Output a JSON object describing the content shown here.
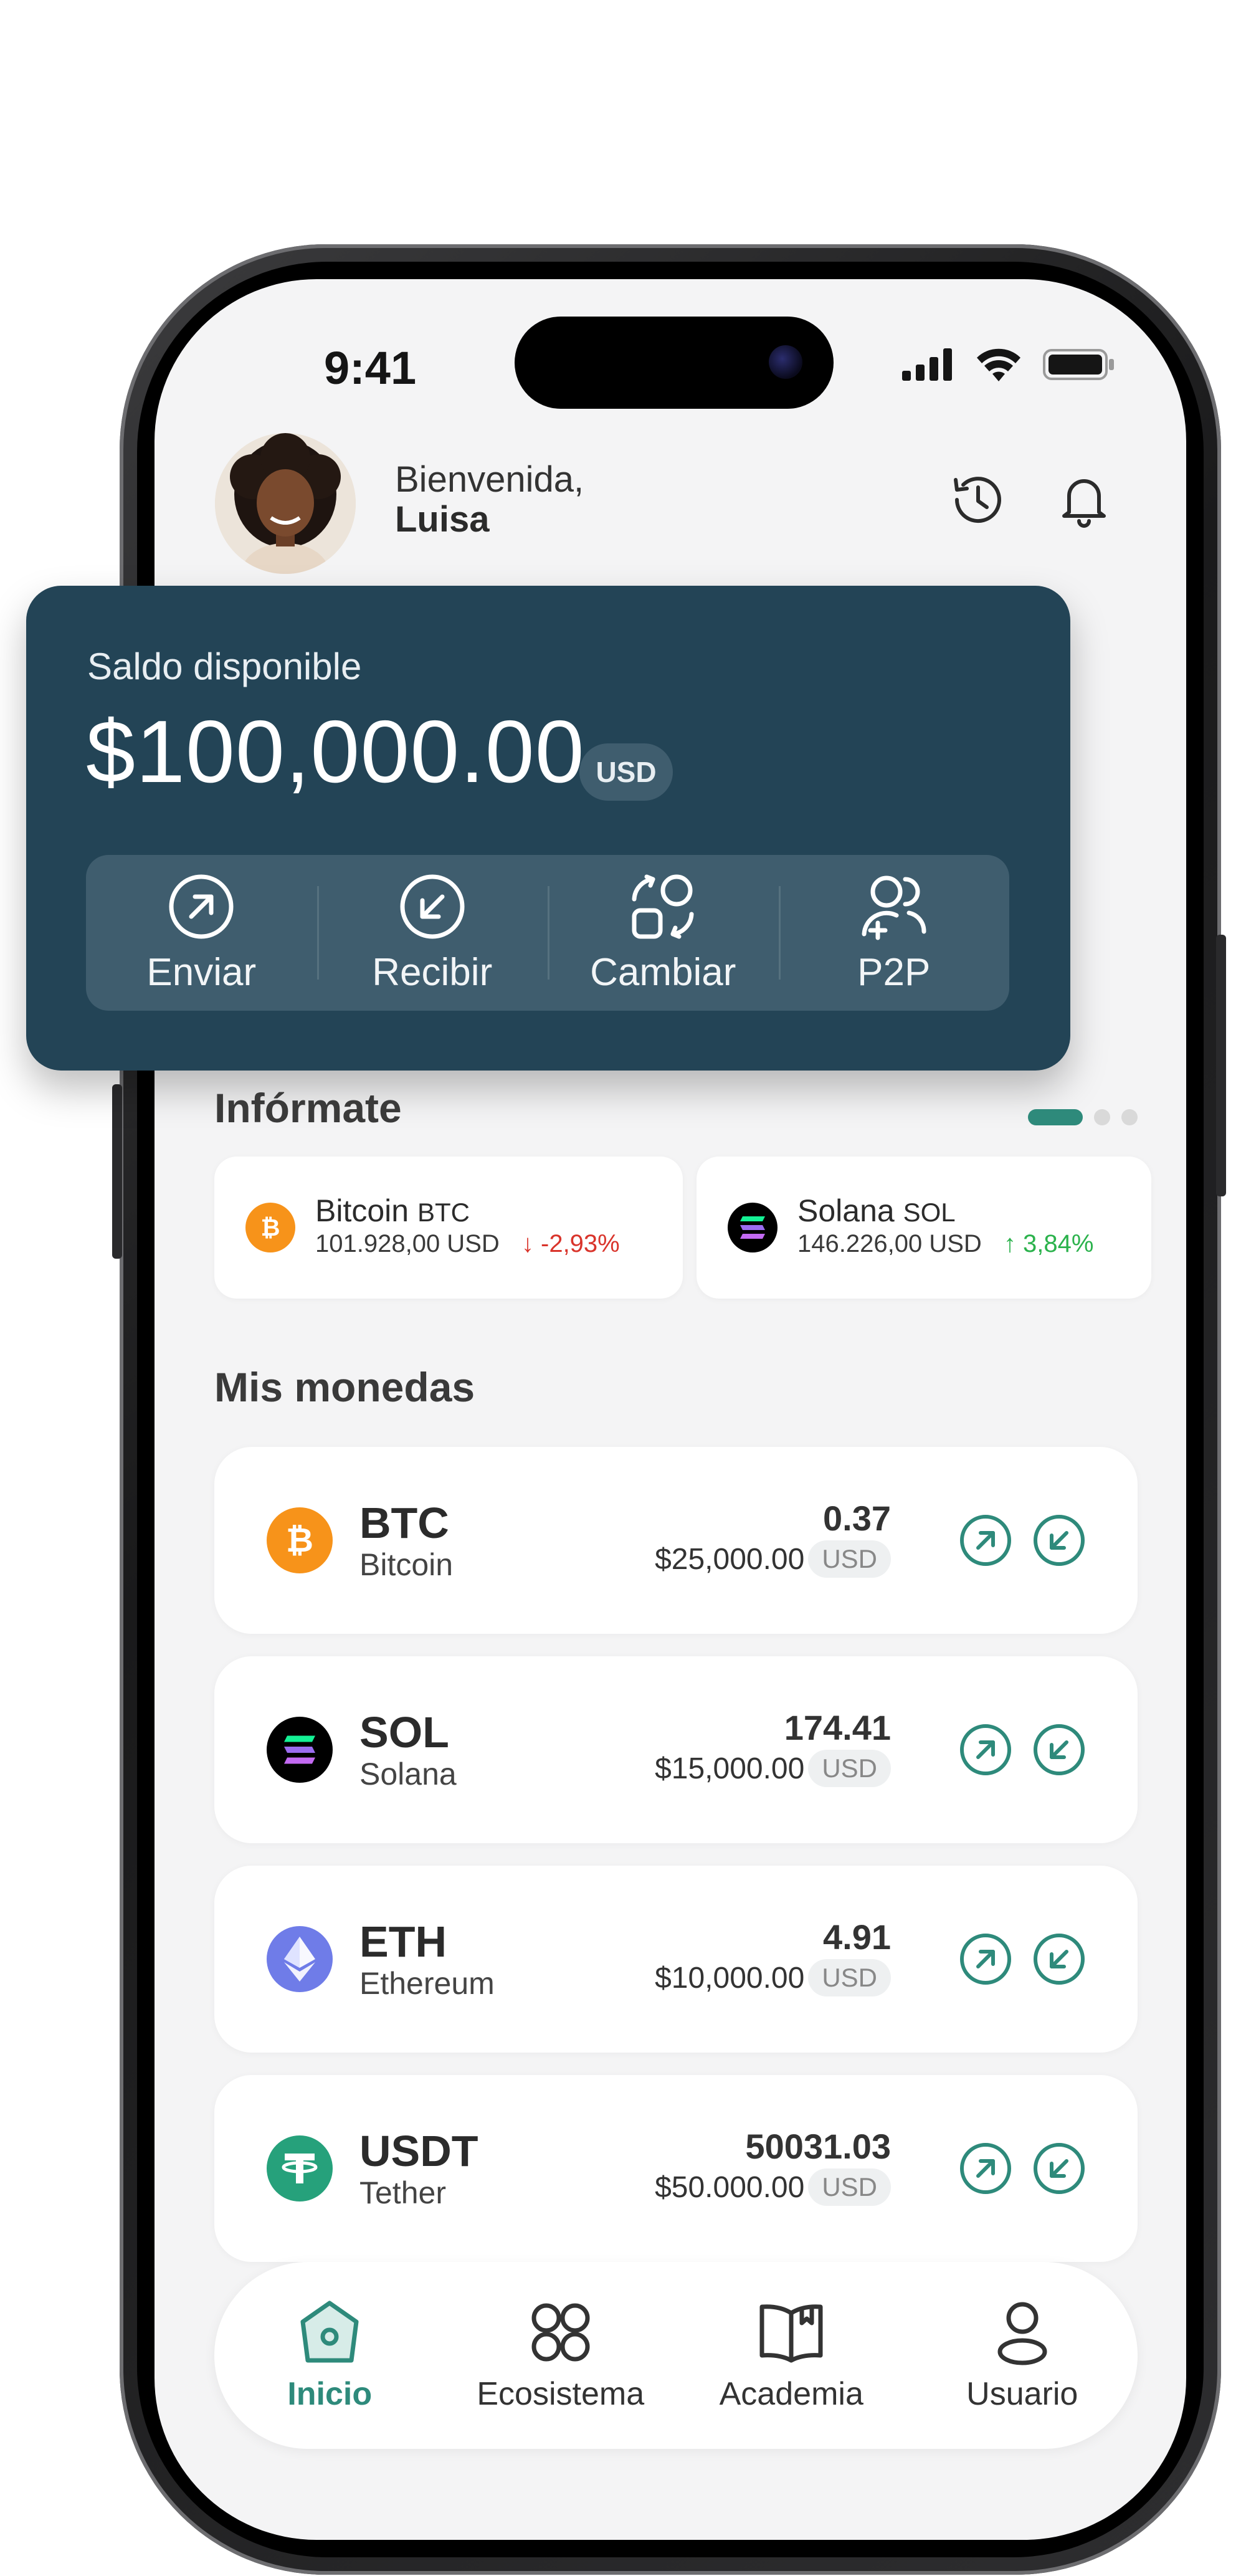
{
  "status_bar": {
    "time": "9:41"
  },
  "header": {
    "greeting": "Bienvenida,",
    "user_name": "Luisa",
    "history_icon": "history-icon",
    "notifications_icon": "bell-icon"
  },
  "balance": {
    "label": "Saldo disponible",
    "amount": "$100,000.00",
    "currency": "USD",
    "actions": [
      {
        "label": "Enviar",
        "icon": "send-arrow-icon"
      },
      {
        "label": "Recibir",
        "icon": "receive-arrow-icon"
      },
      {
        "label": "Cambiar",
        "icon": "swap-icon"
      },
      {
        "label": "P2P",
        "icon": "users-icon"
      }
    ]
  },
  "informate": {
    "title": "Infórmate",
    "carousel_pages": 3,
    "carousel_active": 1,
    "tickers": [
      {
        "name": "Bitcoin",
        "symbol": "BTC",
        "price": "101.928,00 USD",
        "change": "↓ -2,93%",
        "change_color": "#d9342b"
      },
      {
        "name": "Solana",
        "symbol": "SOL",
        "price": "146.226,00 USD",
        "change": "↑ 3,84%",
        "change_color": "#2bb24c"
      }
    ]
  },
  "mis_monedas": {
    "title": "Mis monedas",
    "coins": [
      {
        "symbol": "BTC",
        "name": "Bitcoin",
        "quantity": "0.37",
        "value": "$25,000.00",
        "currency": "USD",
        "color": "#f7931a"
      },
      {
        "symbol": "SOL",
        "name": "Solana",
        "quantity": "174.41",
        "value": "$15,000.00",
        "currency": "USD",
        "color": "#000000"
      },
      {
        "symbol": "ETH",
        "name": "Ethereum",
        "quantity": "4.91",
        "value": "$10,000.00",
        "currency": "USD",
        "color": "#6f7ce8"
      },
      {
        "symbol": "USDT",
        "name": "Tether",
        "quantity": "50031.03",
        "value": "$50.000.00",
        "currency": "USD",
        "color": "#26a17b"
      }
    ]
  },
  "nav": {
    "items": [
      {
        "label": "Inicio",
        "icon": "home-icon",
        "active": true
      },
      {
        "label": "Ecosistema",
        "icon": "grid-icon",
        "active": false
      },
      {
        "label": "Academia",
        "icon": "book-icon",
        "active": false
      },
      {
        "label": "Usuario",
        "icon": "user-icon",
        "active": false
      }
    ]
  },
  "colors": {
    "accent": "#2e8a7b",
    "card_dark": "#234456",
    "screen_bg": "#f4f4f5"
  }
}
